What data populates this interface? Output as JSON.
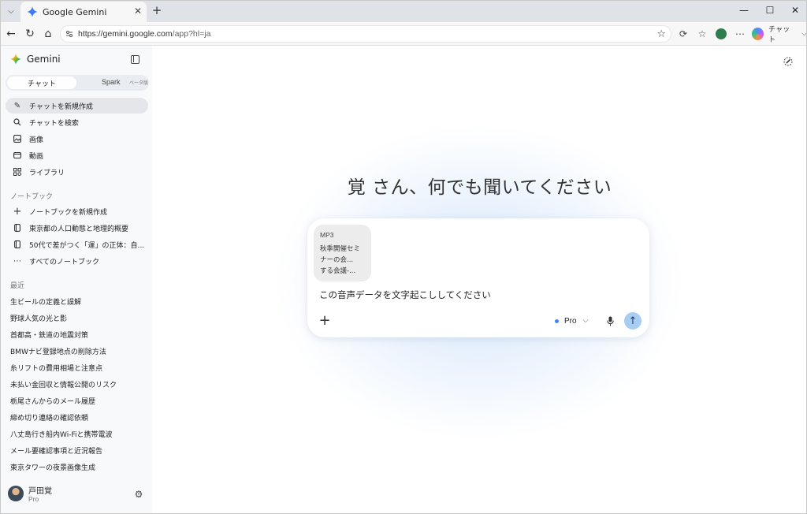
{
  "browser": {
    "tab_title": "Google Gemini",
    "url_host": "https://gemini.google.com",
    "url_path": "/app?hl=ja",
    "copilot_label": "チャット"
  },
  "sidebar": {
    "brand": "Gemini",
    "mode_chat": "チャット",
    "mode_spark": "Spark",
    "mode_beta": "ベータ版",
    "nav_items": [
      {
        "label": "チャットを新規作成",
        "icon": "new-chat-icon"
      },
      {
        "label": "チャットを検索",
        "icon": "search-icon"
      },
      {
        "label": "画像",
        "icon": "image-icon"
      },
      {
        "label": "動画",
        "icon": "video-icon"
      },
      {
        "label": "ライブラリ",
        "icon": "library-icon"
      }
    ],
    "notebook_heading": "ノートブック",
    "notebook_items": [
      {
        "label": "ノートブックを新規作成",
        "icon": "plus-icon"
      },
      {
        "label": "東京都の人口動態と地理的概要",
        "icon": "notebook-icon"
      },
      {
        "label": "50代で差がつく「運」の正体：自...",
        "icon": "notebook-icon"
      },
      {
        "label": "すべてのノートブック",
        "icon": "more-icon"
      }
    ],
    "recent_heading": "最近",
    "recent_items": [
      "生ビールの定義と誤解",
      "野球人気の光と影",
      "首都高・鉄道の地震対策",
      "BMWナビ登録地点の削除方法",
      "糸リフトの費用相場と注意点",
      "未払い金回収と情報公開のリスク",
      "栃尾さんからのメール履歴",
      "締め切り連絡の確認依頼",
      "八丈島行き船内Wi-Fiと携帯電波",
      "メール要確認事項と近況報告",
      "東京タワーの夜景画像生成"
    ],
    "user_name": "戸田覚",
    "user_plan": "Pro"
  },
  "main": {
    "greeting": "覚 さん、何でも聞いてください",
    "attachment": {
      "type": "MP3",
      "name_lines": [
        "秋季開催セミ",
        "ナーの会...",
        "する会議-..."
      ]
    },
    "prompt": "この音声データを文字起こししてください",
    "model": "Pro"
  }
}
